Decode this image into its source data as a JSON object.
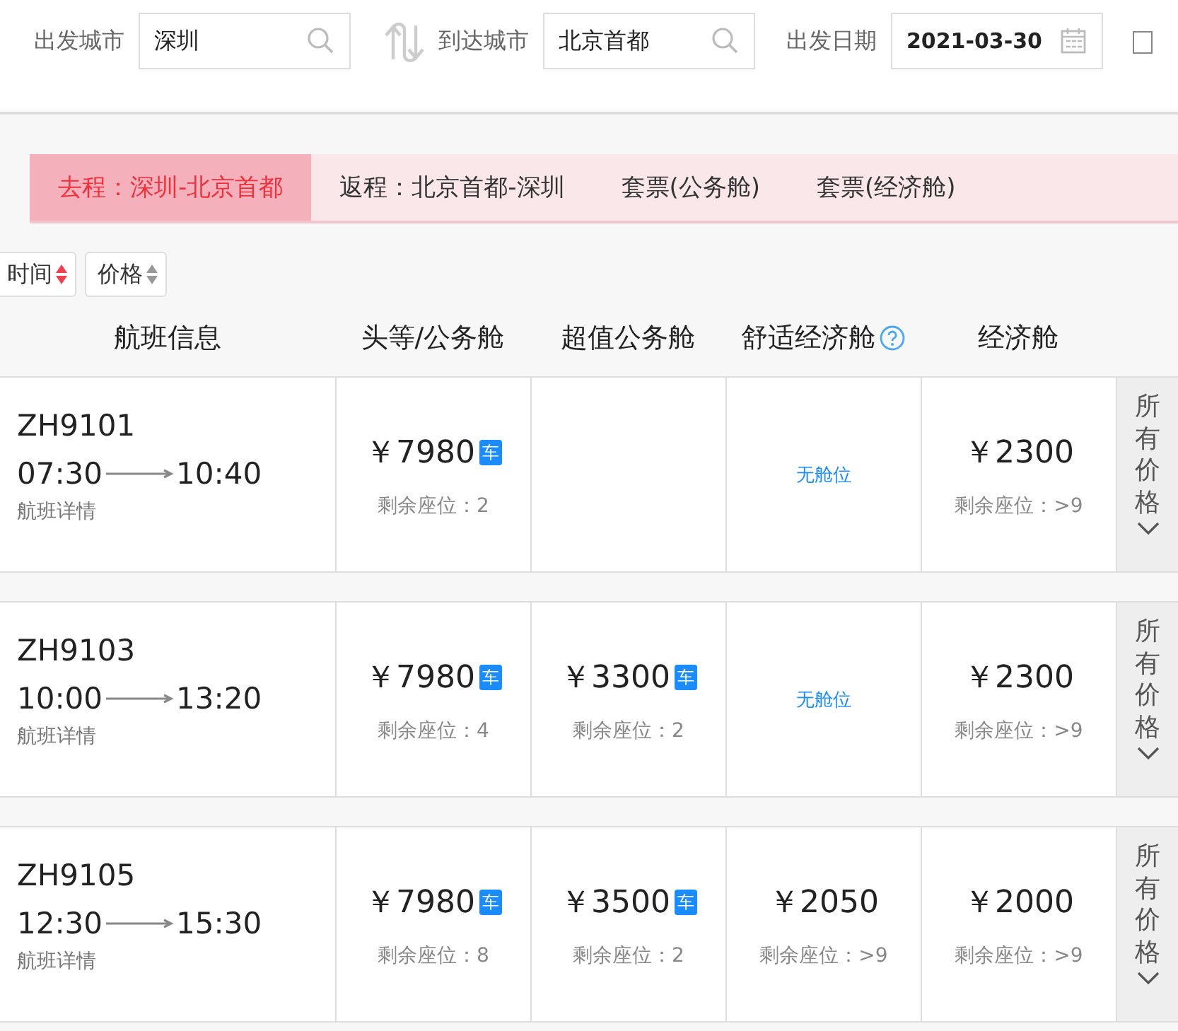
{
  "search": {
    "fields": [
      {
        "label": "出发城市",
        "value": "深圳",
        "kind": "city"
      },
      {
        "label": "到达城市",
        "value": "北京首都",
        "kind": "city"
      },
      {
        "label": "出发日期",
        "value": "2021-03-30",
        "kind": "date"
      }
    ],
    "checkbox": {
      "checked": false
    }
  },
  "tabs": [
    {
      "label": "去程：深圳-北京首都",
      "selected": true
    },
    {
      "label": "返程：北京首都-深圳",
      "selected": false
    },
    {
      "label": "套票(公务舱)",
      "selected": false
    },
    {
      "label": "套票(经济舱)",
      "selected": false
    }
  ],
  "sort_buttons": [
    {
      "label": "时间",
      "selected": true
    },
    {
      "label": "价格",
      "selected": false
    }
  ],
  "table": {
    "columns": [
      {
        "label": "航班信息"
      },
      {
        "label": "头等/公务舱"
      },
      {
        "label": "超值公务舱"
      },
      {
        "label": "舒适经济舱",
        "help": true
      },
      {
        "label": "经济舱"
      }
    ],
    "rows": [
      {
        "more": "所有价格",
        "cells": [
          {
            "kind": "flight",
            "flight": "ZH9101",
            "depart": "07:30",
            "arrive": "10:40",
            "details": "航班详情"
          },
          {
            "kind": "price",
            "price": "￥7980",
            "badge": "车",
            "seats": "剩余座位：2"
          },
          {
            "kind": "empty"
          },
          {
            "kind": "none",
            "text": "无舱位"
          },
          {
            "kind": "price",
            "price": "￥2300",
            "seats": "剩余座位：>9"
          }
        ]
      },
      {
        "more": "所有价格",
        "cells": [
          {
            "kind": "flight",
            "flight": "ZH9103",
            "depart": "10:00",
            "arrive": "13:20",
            "details": "航班详情"
          },
          {
            "kind": "price",
            "price": "￥7980",
            "badge": "车",
            "seats": "剩余座位：4"
          },
          {
            "kind": "price",
            "price": "￥3300",
            "badge": "车",
            "seats": "剩余座位：2"
          },
          {
            "kind": "none",
            "text": "无舱位"
          },
          {
            "kind": "price",
            "price": "￥2300",
            "seats": "剩余座位：>9"
          }
        ]
      },
      {
        "more": "所有价格",
        "cells": [
          {
            "kind": "flight",
            "flight": "ZH9105",
            "depart": "12:30",
            "arrive": "15:30",
            "details": "航班详情"
          },
          {
            "kind": "price",
            "price": "￥7980",
            "badge": "车",
            "seats": "剩余座位：8"
          },
          {
            "kind": "price",
            "price": "￥3500",
            "badge": "车",
            "seats": "剩余座位：2"
          },
          {
            "kind": "price",
            "price": "￥2050",
            "seats": "剩余座位：>9"
          },
          {
            "kind": "price",
            "price": "￥2000",
            "seats": "剩余座位：>9"
          }
        ]
      }
    ]
  }
}
